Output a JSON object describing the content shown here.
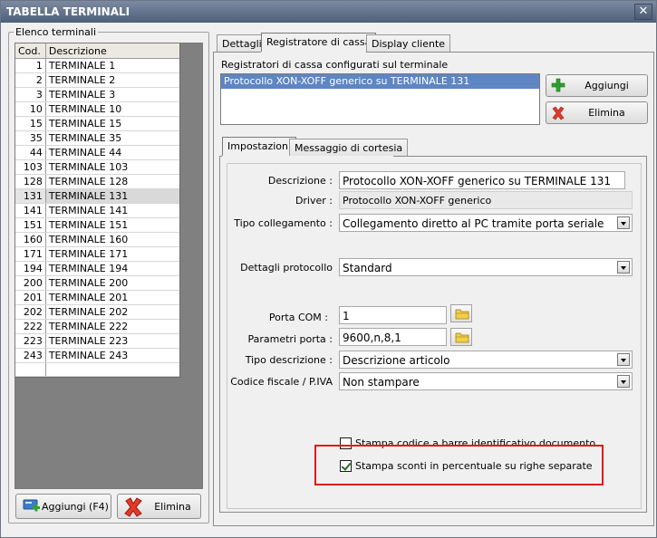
{
  "window": {
    "title": "TABELLA TERMINALI",
    "close_glyph": "✕"
  },
  "left_panel": {
    "group_title": "Elenco terminali",
    "columns": [
      "Cod.",
      "Descrizione"
    ],
    "rows": [
      {
        "code": "1",
        "desc": "TERMINALE 1"
      },
      {
        "code": "2",
        "desc": "TERMINALE 2"
      },
      {
        "code": "3",
        "desc": "TERMINALE 3"
      },
      {
        "code": "10",
        "desc": "TERMINALE 10"
      },
      {
        "code": "15",
        "desc": "TERMINALE 15"
      },
      {
        "code": "35",
        "desc": "TERMINALE 35"
      },
      {
        "code": "44",
        "desc": "TERMINALE 44"
      },
      {
        "code": "103",
        "desc": "TERMINALE 103"
      },
      {
        "code": "128",
        "desc": "TERMINALE 128"
      },
      {
        "code": "131",
        "desc": "TERMINALE 131"
      },
      {
        "code": "141",
        "desc": "TERMINALE 141"
      },
      {
        "code": "151",
        "desc": "TERMINALE 151"
      },
      {
        "code": "160",
        "desc": "TERMINALE 160"
      },
      {
        "code": "171",
        "desc": "TERMINALE 171"
      },
      {
        "code": "194",
        "desc": "TERMINALE 194"
      },
      {
        "code": "200",
        "desc": "TERMINALE 200"
      },
      {
        "code": "201",
        "desc": "TERMINALE 201"
      },
      {
        "code": "202",
        "desc": "TERMINALE 202"
      },
      {
        "code": "222",
        "desc": "TERMINALE 222"
      },
      {
        "code": "223",
        "desc": "TERMINALE 223"
      },
      {
        "code": "243",
        "desc": "TERMINALE 243"
      }
    ],
    "selected_code": "131",
    "add_button": "Aggiungi (F4)",
    "delete_button": "Elimina"
  },
  "tabs": [
    {
      "label": "Dettagli",
      "active": false
    },
    {
      "label": "Registratore di cassa",
      "active": true
    },
    {
      "label": "Display cliente",
      "active": false
    }
  ],
  "registers": {
    "list_label": "Registratori di cassa configurati sul terminale",
    "items": [
      "Protocollo XON-XOFF generico su TERMINALE 131"
    ],
    "add_button": "Aggiungi",
    "delete_button": "Elimina"
  },
  "subtabs": [
    {
      "label": "Impostazioni",
      "active": true
    },
    {
      "label": "Messaggio di cortesia",
      "active": false
    }
  ],
  "form": {
    "descrizione": {
      "label": "Descrizione :",
      "value": "Protocollo XON-XOFF generico su TERMINALE 131"
    },
    "driver": {
      "label": "Driver :",
      "value": "Protocollo XON-XOFF generico"
    },
    "tipo_collegamento": {
      "label": "Tipo collegamento :",
      "value": "Collegamento diretto al PC tramite porta seriale"
    },
    "dettagli_protocollo": {
      "label": "Dettagli protocollo",
      "value": "Standard"
    },
    "porta_com": {
      "label": "Porta COM :",
      "value": "1"
    },
    "parametri_porta": {
      "label": "Parametri porta :",
      "value": "9600,n,8,1"
    },
    "tipo_descrizione": {
      "label": "Tipo descrizione :",
      "value": "Descrizione articolo"
    },
    "codice_fiscale": {
      "label": "Codice fiscale / P.IVA",
      "value": "Non stampare"
    },
    "check_barcode": {
      "label": "Stampa codice a barre identificativo documento",
      "checked": false
    },
    "check_sconti": {
      "label": "Stampa sconti in percentuale su righe separate",
      "checked": true
    }
  },
  "colors": {
    "selection": "#5d86c2",
    "highlight_border": "#e01a1a",
    "title_bar": "#4e5f79"
  },
  "icons": {
    "add": "plus-icon",
    "delete": "x-icon",
    "folder": "folder-icon",
    "card": "card-icon"
  }
}
